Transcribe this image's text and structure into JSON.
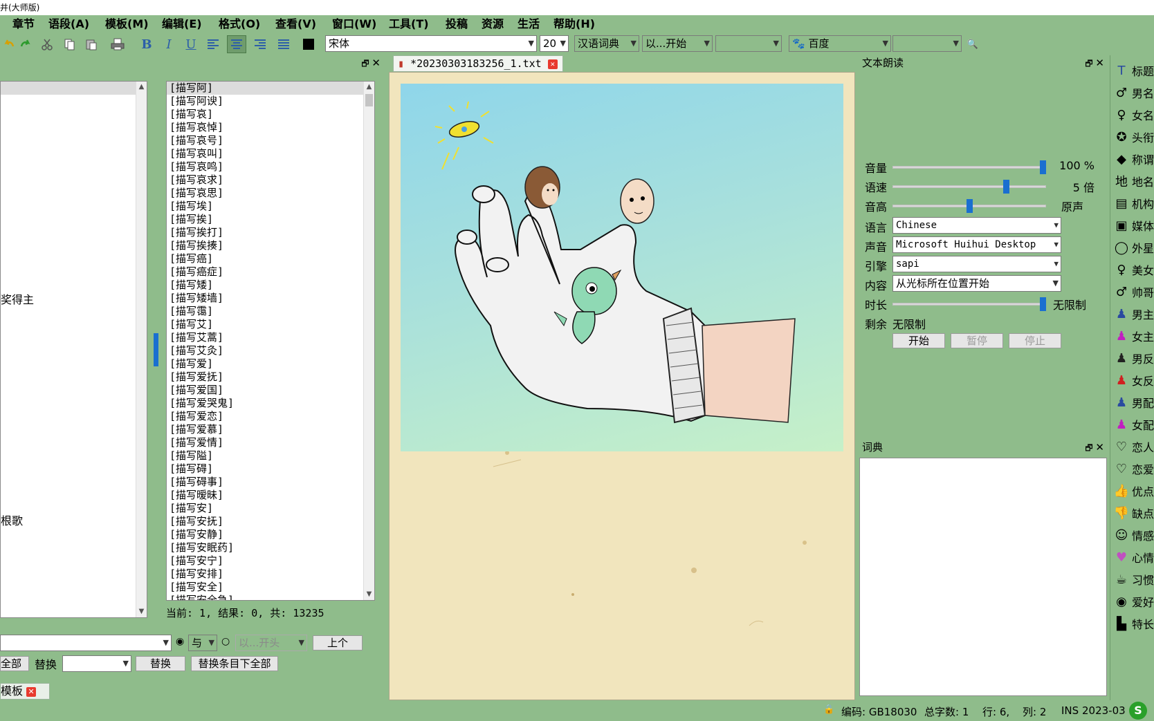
{
  "window": {
    "title": "井(大师版)"
  },
  "menu": [
    "章节",
    "语段(A)",
    "模板(M)",
    "编辑(E)",
    "格式(O)",
    "查看(V)",
    "窗口(W)",
    "工具(T)",
    "投稿",
    "资源",
    "生活",
    "帮助(H)"
  ],
  "toolbar": {
    "font": "宋体",
    "size": "20",
    "dict": "汉语词典",
    "match_mode": "以...开始",
    "search_engine": "百度"
  },
  "left_panel": {
    "partial_items": [
      {
        "text": "奖得主"
      },
      {
        "text": "根歌"
      }
    ],
    "list_items": [
      "[描写阿]",
      "[描写阿谀]",
      "[描写哀]",
      "[描写哀悼]",
      "[描写哀号]",
      "[描写哀叫]",
      "[描写哀鸣]",
      "[描写哀求]",
      "[描写哀思]",
      "[描写埃]",
      "[描写挨]",
      "[描写挨打]",
      "[描写挨揍]",
      "[描写癌]",
      "[描写癌症]",
      "[描写矮]",
      "[描写矮墙]",
      "[描写霭]",
      "[描写艾]",
      "[描写艾蒿]",
      "[描写艾灸]",
      "[描写爱]",
      "[描写爱抚]",
      "[描写爱国]",
      "[描写爱哭鬼]",
      "[描写爱恋]",
      "[描写爱慕]",
      "[描写爱情]",
      "[描写隘]",
      "[描写碍]",
      "[描写碍事]",
      "[描写暧昧]",
      "[描写安]",
      "[描写安抚]",
      "[描写安静]",
      "[描写安眠药]",
      "[描写安宁]",
      "[描写安排]",
      "[描写安全]",
      "[描写安全急]"
    ],
    "result_line": "当前: 1, 结果: 0, 共: 13235",
    "search": {
      "and_option": "与",
      "match_option": "以...开头",
      "prev_button": "上个"
    },
    "replace": {
      "all_button_partial": "全部",
      "label": "替换",
      "replace_button": "替换",
      "replace_all_button": "替换条目下全部"
    },
    "bottom_tab": "模板"
  },
  "editor": {
    "tab_title": "*20230303183256_1.txt"
  },
  "tts": {
    "title": "文本朗读",
    "volume_label": "音量",
    "volume_value": "100 %",
    "volume_level": 1.0,
    "speed_label": "语速",
    "speed_value": "5 倍",
    "speed_level": 0.75,
    "pitch_label": "音高",
    "pitch_value": "原声",
    "pitch_level": 0.5,
    "language_label": "语言",
    "language": "Chinese",
    "voice_label": "声音",
    "voice": "Microsoft Huihui Desktop",
    "engine_label": "引擎",
    "engine": "sapi",
    "content_label": "内容",
    "content": "从光标所在位置开始",
    "duration_label": "时长",
    "duration_value": "无限制",
    "duration_level": 1.0,
    "remaining_label": "剩余",
    "remaining_value": "无限制",
    "start_button": "开始",
    "pause_button": "暂停",
    "stop_button": "停止"
  },
  "dictionary": {
    "title": "词典"
  },
  "sidebar": [
    {
      "label": "标题",
      "icon": "title-icon"
    },
    {
      "label": "男名",
      "icon": "male-symbol-icon"
    },
    {
      "label": "女名",
      "icon": "female-symbol-icon"
    },
    {
      "label": "头衔",
      "icon": "medal-icon"
    },
    {
      "label": "称谓",
      "icon": "tag-icon"
    },
    {
      "label": "地名",
      "icon": "place-icon"
    },
    {
      "label": "机构",
      "icon": "building-icon"
    },
    {
      "label": "媒体",
      "icon": "media-icon"
    },
    {
      "label": "外星",
      "icon": "alien-icon"
    },
    {
      "label": "美女",
      "icon": "beauty-icon"
    },
    {
      "label": "帅哥",
      "icon": "handsome-icon"
    },
    {
      "label": "男主",
      "icon": "male-lead-icon"
    },
    {
      "label": "女主",
      "icon": "female-lead-icon"
    },
    {
      "label": "男反",
      "icon": "male-villain-icon"
    },
    {
      "label": "女反",
      "icon": "female-villain-icon"
    },
    {
      "label": "男配",
      "icon": "male-support-icon"
    },
    {
      "label": "女配",
      "icon": "female-support-icon"
    },
    {
      "label": "恋人",
      "icon": "heart-icon"
    },
    {
      "label": "恋爱",
      "icon": "love-icon"
    },
    {
      "label": "优点",
      "icon": "thumbs-up-icon"
    },
    {
      "label": "缺点",
      "icon": "thumbs-down-icon"
    },
    {
      "label": "情感",
      "icon": "emotion-icon"
    },
    {
      "label": "心情",
      "icon": "mood-icon"
    },
    {
      "label": "习惯",
      "icon": "cup-icon"
    },
    {
      "label": "爱好",
      "icon": "hobby-icon"
    },
    {
      "label": "特长",
      "icon": "skill-icon"
    }
  ],
  "status": {
    "encoding": "编码: GB18030",
    "word_count": "总字数: 1",
    "row": "行: 6,",
    "col": "列: 2",
    "mode": "INS",
    "date": "2023-03"
  },
  "colors": {
    "app_green": "#8fbc8b",
    "accent_blue": "#1a6fd0",
    "close_red": "#e83a2e"
  }
}
